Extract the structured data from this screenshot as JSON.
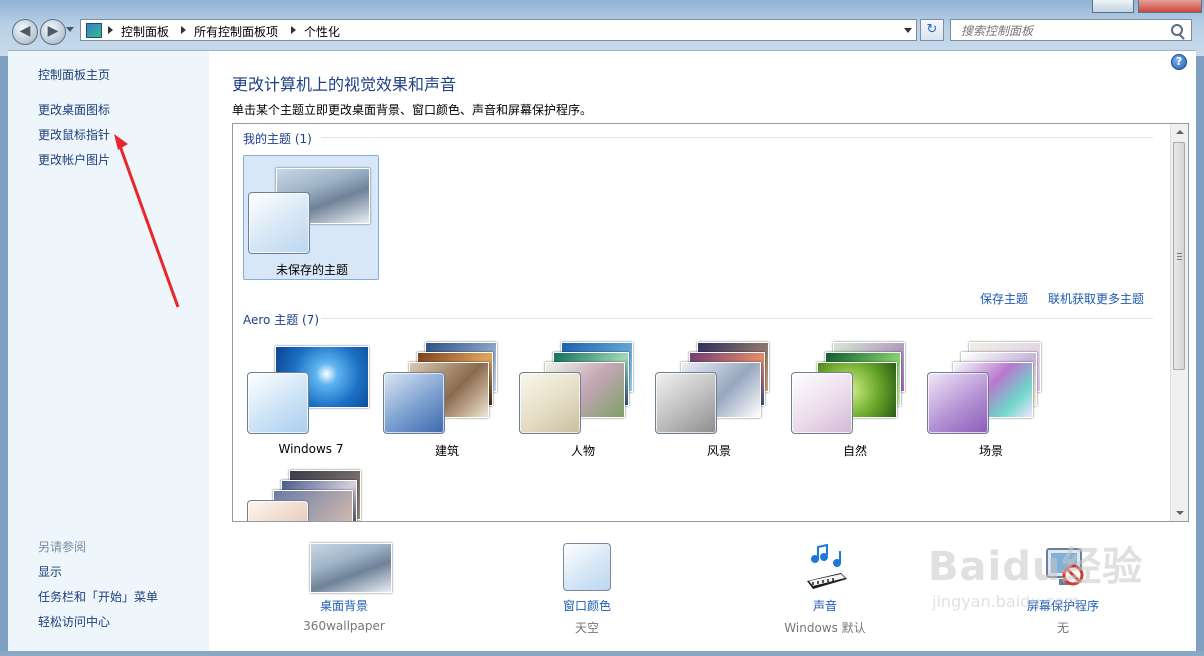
{
  "window": {
    "breadcrumb": [
      "控制面板",
      "所有控制面板项",
      "个性化"
    ],
    "search_placeholder": "搜索控制面板"
  },
  "left_pane": {
    "home": "控制面板主页",
    "tasks": [
      "更改桌面图标",
      "更改鼠标指针",
      "更改帐户图片"
    ],
    "see_also_title": "另请参阅",
    "see_also": [
      "显示",
      "任务栏和「开始」菜单",
      "轻松访问中心"
    ]
  },
  "main": {
    "title": "更改计算机上的视觉效果和声音",
    "subtitle": "单击某个主题立即更改桌面背景、窗口颜色、声音和屏幕保护程序。",
    "my_themes_title": "我的主题 (1)",
    "my_themes": [
      {
        "label": "未保存的主题",
        "selected": true
      }
    ],
    "save_theme": "保存主题",
    "get_more_themes": "联机获取更多主题",
    "aero_title": "Aero 主题 (7)",
    "aero_themes": [
      "Windows 7",
      "建筑",
      "人物",
      "风景",
      "自然",
      "场景",
      ""
    ]
  },
  "settings": [
    {
      "label": "桌面背景",
      "value": "360wallpaper",
      "icon": "wallpaper-thumbnail"
    },
    {
      "label": "窗口颜色",
      "value": "天空",
      "icon": "window-color-swatch"
    },
    {
      "label": "声音",
      "value": "Windows 默认",
      "icon": "sound-icon"
    },
    {
      "label": "屏幕保护程序",
      "value": "无",
      "icon": "screensaver-icon"
    }
  ],
  "watermark": {
    "text": "Baidu经验",
    "subtext": "jingyan.baidu.com"
  },
  "colors": {
    "link": "#1e5bb3",
    "title": "#1e3f8a",
    "annotation_arrow": "#e8262b",
    "selection": "#d7e7f8"
  }
}
